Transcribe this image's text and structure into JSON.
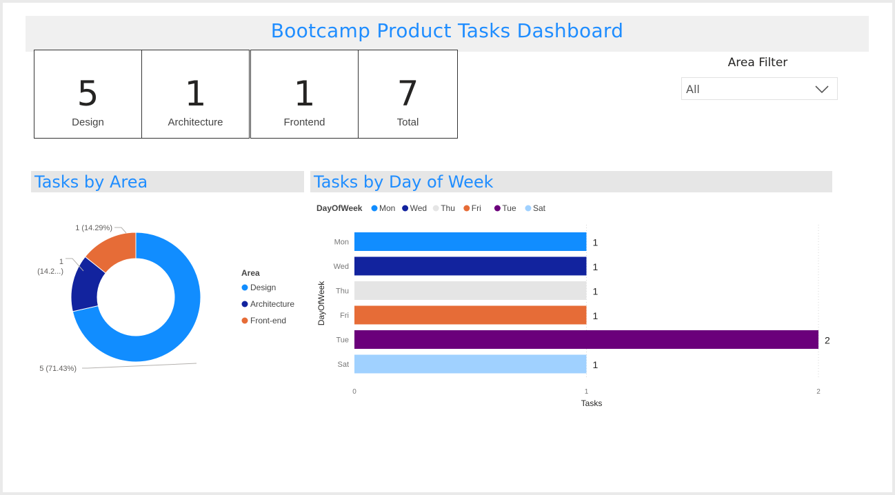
{
  "title": "Bootcamp Product Tasks Dashboard",
  "cards": [
    {
      "value": "5",
      "label": "Design"
    },
    {
      "value": "1",
      "label": "Architecture"
    },
    {
      "value": "1",
      "label": "Frontend"
    },
    {
      "value": "7",
      "label": "Total"
    }
  ],
  "filter": {
    "title": "Area Filter",
    "selected": "All"
  },
  "sections": {
    "area": "Tasks by Area",
    "day": "Tasks by Day of Week"
  },
  "colors": {
    "design": "#118dff",
    "architecture": "#12239e",
    "frontend": "#e66c37",
    "mon": "#118dff",
    "wed": "#12239e",
    "thu": "#e5e5e5",
    "fri": "#e66c37",
    "tue": "#6b007b",
    "sat": "#a0d1ff"
  },
  "chart_data": [
    {
      "type": "pie",
      "donut": true,
      "legend_title": "Area",
      "legend_placement": "right",
      "slices": [
        {
          "name": "Design",
          "value": 5,
          "label": "5 (71.43%)"
        },
        {
          "name": "Architecture",
          "value": 1,
          "label": "1 (14.2...)"
        },
        {
          "name": "Front-end",
          "value": 1,
          "label": "1 (14.29%)"
        }
      ]
    },
    {
      "type": "bar",
      "orientation": "horizontal",
      "legend_title": "DayOfWeek",
      "legend_placement": "top-left",
      "categories": [
        "Mon",
        "Wed",
        "Thu",
        "Fri",
        "Tue",
        "Sat"
      ],
      "values": [
        1,
        1,
        1,
        1,
        2,
        1
      ],
      "xlabel": "Tasks",
      "ylabel": "DayOfWeek",
      "xlim": [
        0,
        2
      ],
      "xticks": [
        "0",
        "1",
        "2"
      ],
      "grid": true
    }
  ]
}
